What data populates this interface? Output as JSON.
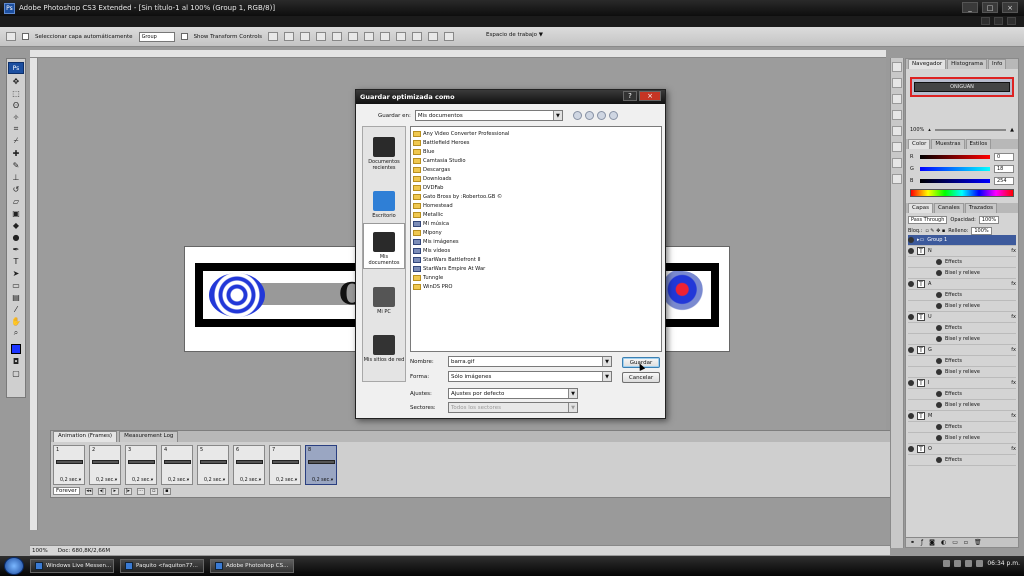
{
  "window": {
    "title": "Adobe Photoshop CS3 Extended - [Sin título-1 al 100% (Group 1, RGB/8)]",
    "ps_badge": "Ps",
    "min": "_",
    "max": "□",
    "close": "×"
  },
  "options_bar": {
    "auto_select_label": "Seleccionar capa automáticamente",
    "auto_select_value": "Group",
    "transform_label": "Show Transform Controls",
    "workspace_label": "Espacio de trabajo ▼"
  },
  "toolbox": {
    "badge": "Ps"
  },
  "canvas": {
    "letter": "O",
    "colors": {
      "frame": "#000000",
      "bar": "#999999",
      "swirl": "#2238d8"
    }
  },
  "dialog": {
    "title": "Guardar optimizada como",
    "help": "?",
    "close": "×",
    "save_in_label": "Guardar en:",
    "save_in_value": "Mis documentos",
    "places": [
      {
        "label": "Documentos recientes",
        "icon": "recent-docs-icon"
      },
      {
        "label": "Escritorio",
        "icon": "desktop-icon"
      },
      {
        "label": "Mis documentos",
        "icon": "my-documents-icon"
      },
      {
        "label": "Mi PC",
        "icon": "my-computer-icon"
      },
      {
        "label": "Mis sitios de red",
        "icon": "network-places-icon"
      }
    ],
    "files": [
      "Any Video Converter Professional",
      "Battlefield Heroes",
      "Blue",
      "Camtasia Studio",
      "Descargas",
      "Downloads",
      "DVDFab",
      "Gato Bross by :Robertoo.GB ©",
      "Homestead",
      "Metallic",
      "Mi música",
      "Mipony",
      "Mis imágenes",
      "Mis vídeos",
      "StarWars Battlefront II",
      "StarWars Empire At War",
      "Tunngle",
      "WinDS PRO"
    ],
    "name_label": "Nombre:",
    "name_value": "barra.gif",
    "format_label": "Forma:",
    "format_value": "Sólo imágenes",
    "settings_label": "Ajustes:",
    "settings_value": "Ajustes por defecto",
    "slices_label": "Sectores:",
    "slices_value": "Todos los sectores",
    "save_button": "Guardar",
    "cancel_button": "Cancelar"
  },
  "animation": {
    "tab_active": "Animation (Frames)",
    "tab_inactive": "Measurement Log",
    "frames": [
      {
        "num": "1",
        "delay": "0,2 sec."
      },
      {
        "num": "2",
        "delay": "0,2 sec."
      },
      {
        "num": "3",
        "delay": "0,2 sec."
      },
      {
        "num": "4",
        "delay": "0,2 sec."
      },
      {
        "num": "5",
        "delay": "0,2 sec."
      },
      {
        "num": "6",
        "delay": "0,2 sec."
      },
      {
        "num": "7",
        "delay": "0,2 sec."
      },
      {
        "num": "8",
        "delay": "0,2 sec."
      }
    ],
    "selected_frame": "8",
    "loop": "Forever"
  },
  "status": {
    "zoom": "100%",
    "doc": "Doc: 680,8K/2,66M"
  },
  "panels": {
    "nav_tabs": [
      "Navegador",
      "Histograma",
      "Info"
    ],
    "nav_text": "ONIGUAN",
    "nav_zoom": "100%",
    "color_tabs": [
      "Color",
      "Muestras",
      "Estilos"
    ],
    "color": {
      "r_label": "R",
      "g_label": "G",
      "b_label": "B",
      "r": "0",
      "g": "18",
      "b": "254"
    },
    "layer_tabs": [
      "Capas",
      "Canales",
      "Trazados"
    ],
    "blend": "Pass Through",
    "opacity_label": "Opacidad:",
    "opacity": "100%",
    "lock_label": "Bloq.:",
    "fill_label": "Relleno:",
    "fill": "100%",
    "layers": [
      {
        "kind": "group",
        "name": "Group 1"
      },
      {
        "kind": "text",
        "name": "N"
      },
      {
        "kind": "effects",
        "name": "Effects"
      },
      {
        "kind": "effect",
        "name": "Bisel y relieve"
      },
      {
        "kind": "text",
        "name": "A"
      },
      {
        "kind": "effects",
        "name": "Effects"
      },
      {
        "kind": "effect",
        "name": "Bisel y relieve"
      },
      {
        "kind": "text",
        "name": "U"
      },
      {
        "kind": "effects",
        "name": "Effects"
      },
      {
        "kind": "effect",
        "name": "Bisel y relieve"
      },
      {
        "kind": "text",
        "name": "G"
      },
      {
        "kind": "effects",
        "name": "Effects"
      },
      {
        "kind": "effect",
        "name": "Bisel y relieve"
      },
      {
        "kind": "text",
        "name": "I"
      },
      {
        "kind": "effects",
        "name": "Effects"
      },
      {
        "kind": "effect",
        "name": "Bisel y relieve"
      },
      {
        "kind": "text",
        "name": "M"
      },
      {
        "kind": "effects",
        "name": "Effects"
      },
      {
        "kind": "effect",
        "name": "Bisel y relieve"
      },
      {
        "kind": "text",
        "name": "O"
      },
      {
        "kind": "effects",
        "name": "Effects"
      }
    ]
  },
  "taskbar": {
    "tasks": [
      "Windows Live Messen...",
      "Paquito <faquiton77...",
      "Adobe Photoshop CS..."
    ],
    "clock": "06:34 p.m."
  }
}
